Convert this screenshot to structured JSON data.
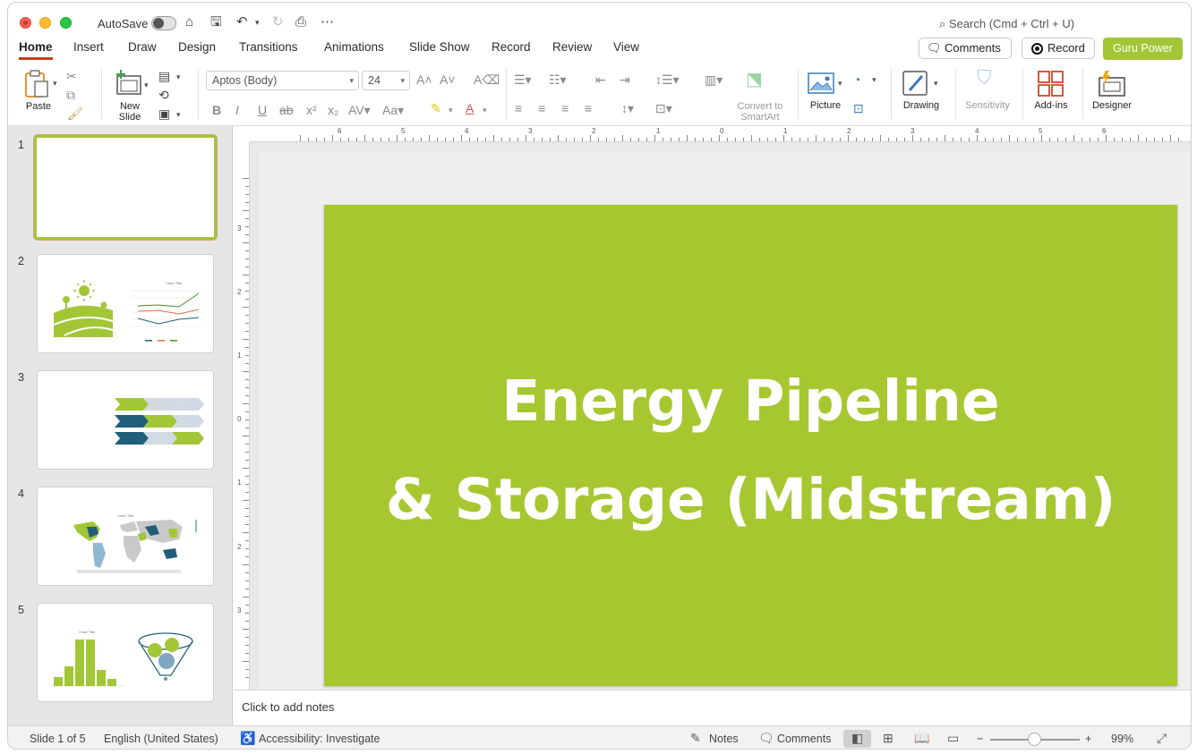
{
  "titlebar": {
    "autosave_label": "AutoSave",
    "search_placeholder": "Search (Cmd + Ctrl + U)"
  },
  "tabs": [
    "Home",
    "Insert",
    "Draw",
    "Design",
    "Transitions",
    "Animations",
    "Slide Show",
    "Record",
    "Review",
    "View"
  ],
  "active_tab": "Home",
  "topright": {
    "comments_label": "Comments",
    "record_label": "Record",
    "guru_label": "Guru Power"
  },
  "ribbon": {
    "paste": "Paste",
    "new_slide_line1": "New",
    "new_slide_line2": "Slide",
    "font_name": "Aptos (Body)",
    "font_size": "24",
    "convert_line1": "Convert to",
    "convert_line2": "SmartArt",
    "picture": "Picture",
    "drawing": "Drawing",
    "sensitivity": "Sensitivity",
    "addins": "Add-ins",
    "designer": "Designer"
  },
  "thumbnails": {
    "numbers": [
      "1",
      "2",
      "3",
      "4",
      "5"
    ],
    "slide2_chart_title": "Chart Title",
    "slide4_chart_title": "Chart Title",
    "slide5_chart_title": "Chart Title"
  },
  "ruler": {
    "h_labels": [
      "6",
      "5",
      "4",
      "3",
      "2",
      "1",
      "0",
      "1",
      "2",
      "3",
      "4",
      "5",
      "6"
    ],
    "v_labels": [
      "3",
      "2",
      "1",
      "0",
      "1",
      "2",
      "3"
    ]
  },
  "slide": {
    "title_line1": "Energy Pipeline",
    "title_line2": "& Storage (Midstream)",
    "background": "#a6c72f"
  },
  "notes": {
    "placeholder": "Click to add notes"
  },
  "status": {
    "slide_info": "Slide 1 of 5",
    "language": "English (United States)",
    "accessibility": "Accessibility: Investigate",
    "notes": "Notes",
    "comments": "Comments",
    "zoom": "99%"
  },
  "colors": {
    "accent_green": "#a3c637",
    "navy": "#1f5f7a",
    "tab_underline": "#c43e1c"
  }
}
